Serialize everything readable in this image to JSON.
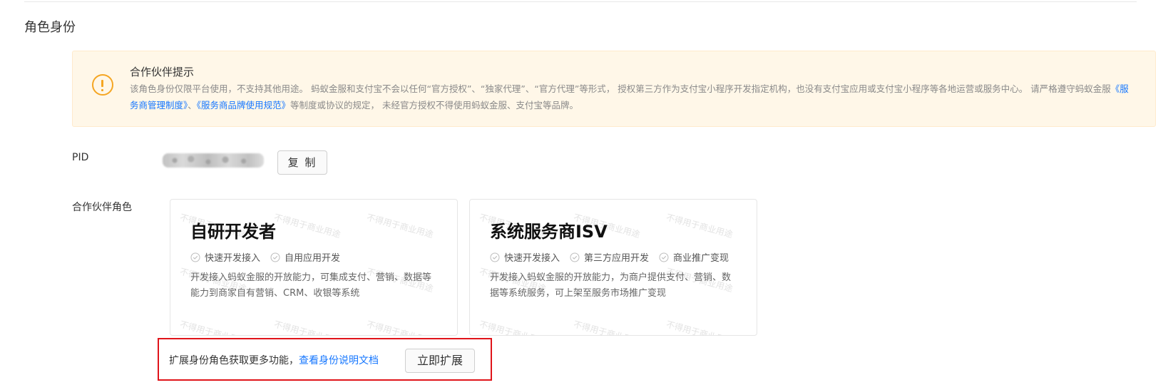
{
  "section": {
    "title": "角色身份"
  },
  "alert": {
    "icon": "warning-circle-icon",
    "title": "合作伙伴提示",
    "body_part1": "该角色身份仅限平台使用，不支持其他用途。 蚂蚁金服和支付宝不会以任何“官方授权”、“独家代理”、“官方代理”等形式， 授权第三方作为支付宝小程序开发指定机构，也没有支付宝应用或支付宝小程序等各地运营或服务中心。 请严格遵守蚂蚁金服",
    "link1": "《服务商管理制度》",
    "separator": "、",
    "link2": "《服务商品牌使用规范》",
    "body_part2": "等制度或协议的规定， 未经官方授权不得使用蚂蚁金服、支付宝等品牌。",
    "colors": {
      "background": "#fff7e8",
      "icon": "#f5a623",
      "link": "#1677ff"
    }
  },
  "pid": {
    "label": "PID",
    "copy_label": "复 制"
  },
  "roles": {
    "label": "合作伙伴角色",
    "watermark_text": "不得用于商业用途",
    "cards": [
      {
        "title": "自研开发者",
        "tags": [
          "快速开发接入",
          "自用应用开发"
        ],
        "description": "开发接入蚂蚁金服的开放能力，可集成支付、营销、数据等能力到商家自有营销、CRM、收银等系统"
      },
      {
        "title": "系统服务商ISV",
        "tags": [
          "快速开发接入",
          "第三方应用开发",
          "商业推广变现"
        ],
        "description": "开发接入蚂蚁金服的开放能力，为商户提供支付、营销、数据等系统服务，可上架至服务市场推广变现"
      }
    ]
  },
  "expand": {
    "text": "扩展身份角色获取更多功能，",
    "link": "查看身份说明文档",
    "button_label": "立即扩展",
    "highlight_color": "#e0141a"
  }
}
